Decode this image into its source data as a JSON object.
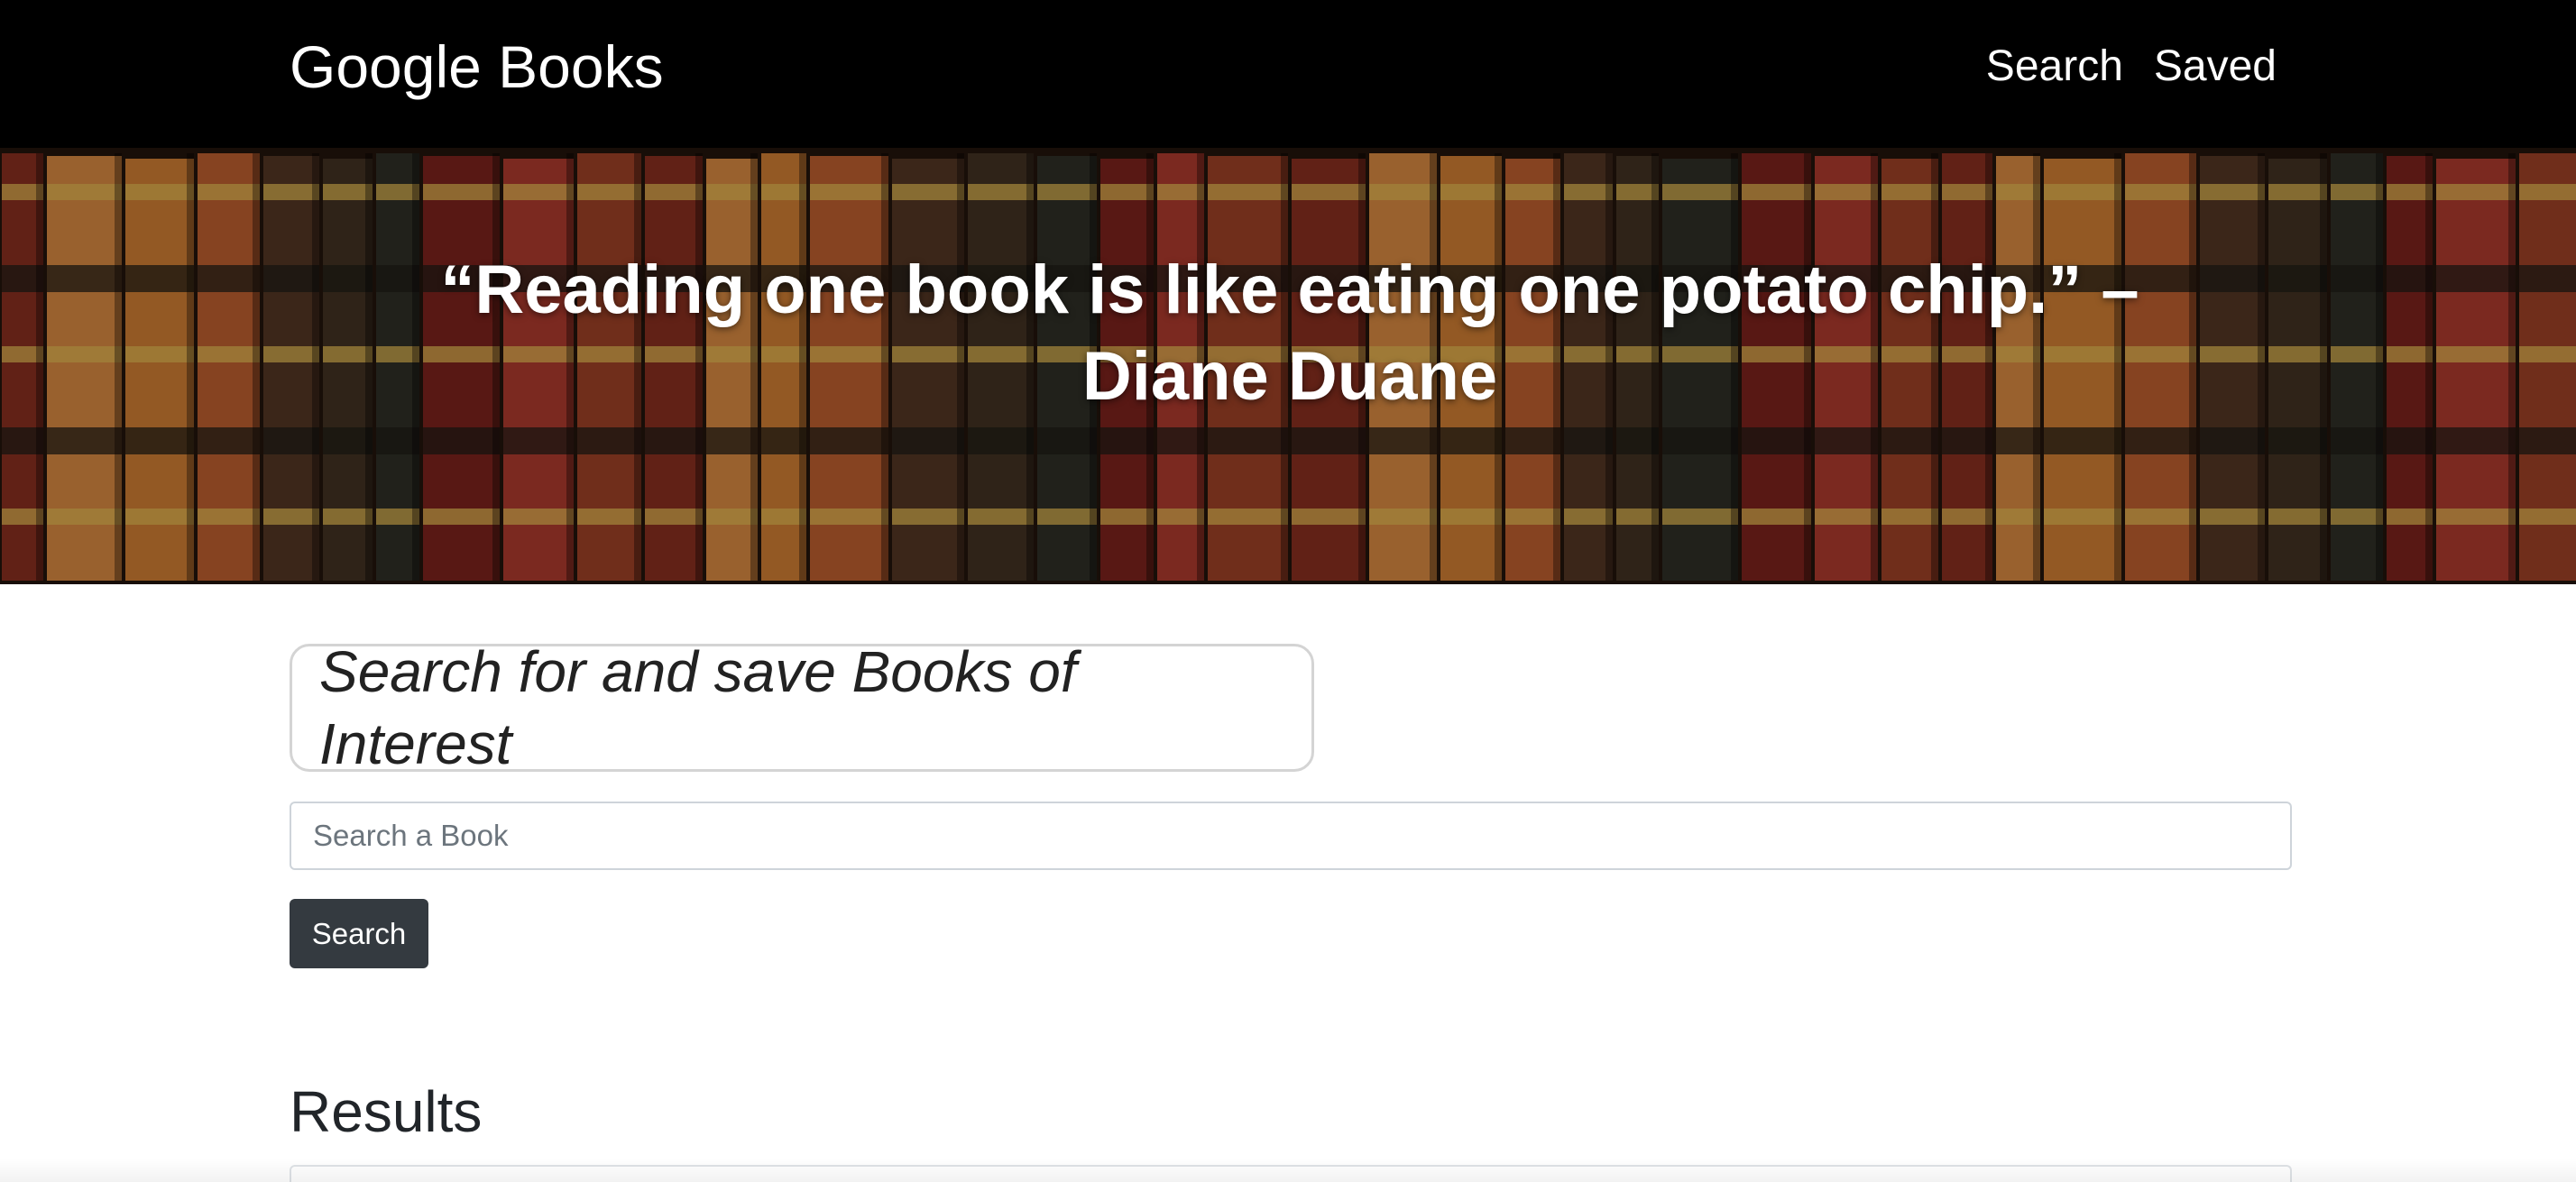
{
  "navbar": {
    "brand": "Google Books",
    "links": [
      {
        "label": "Search"
      },
      {
        "label": "Saved"
      }
    ],
    "background": "#000000"
  },
  "hero": {
    "quote": "“Reading one book is like eating one potato chip.” – Diane Duane"
  },
  "main": {
    "tagline": "Search for and save Books of Interest",
    "search": {
      "placeholder": "Search a Book",
      "value": "",
      "button_label": "Search",
      "button_color": "#343a40"
    },
    "results_heading": "Results"
  }
}
